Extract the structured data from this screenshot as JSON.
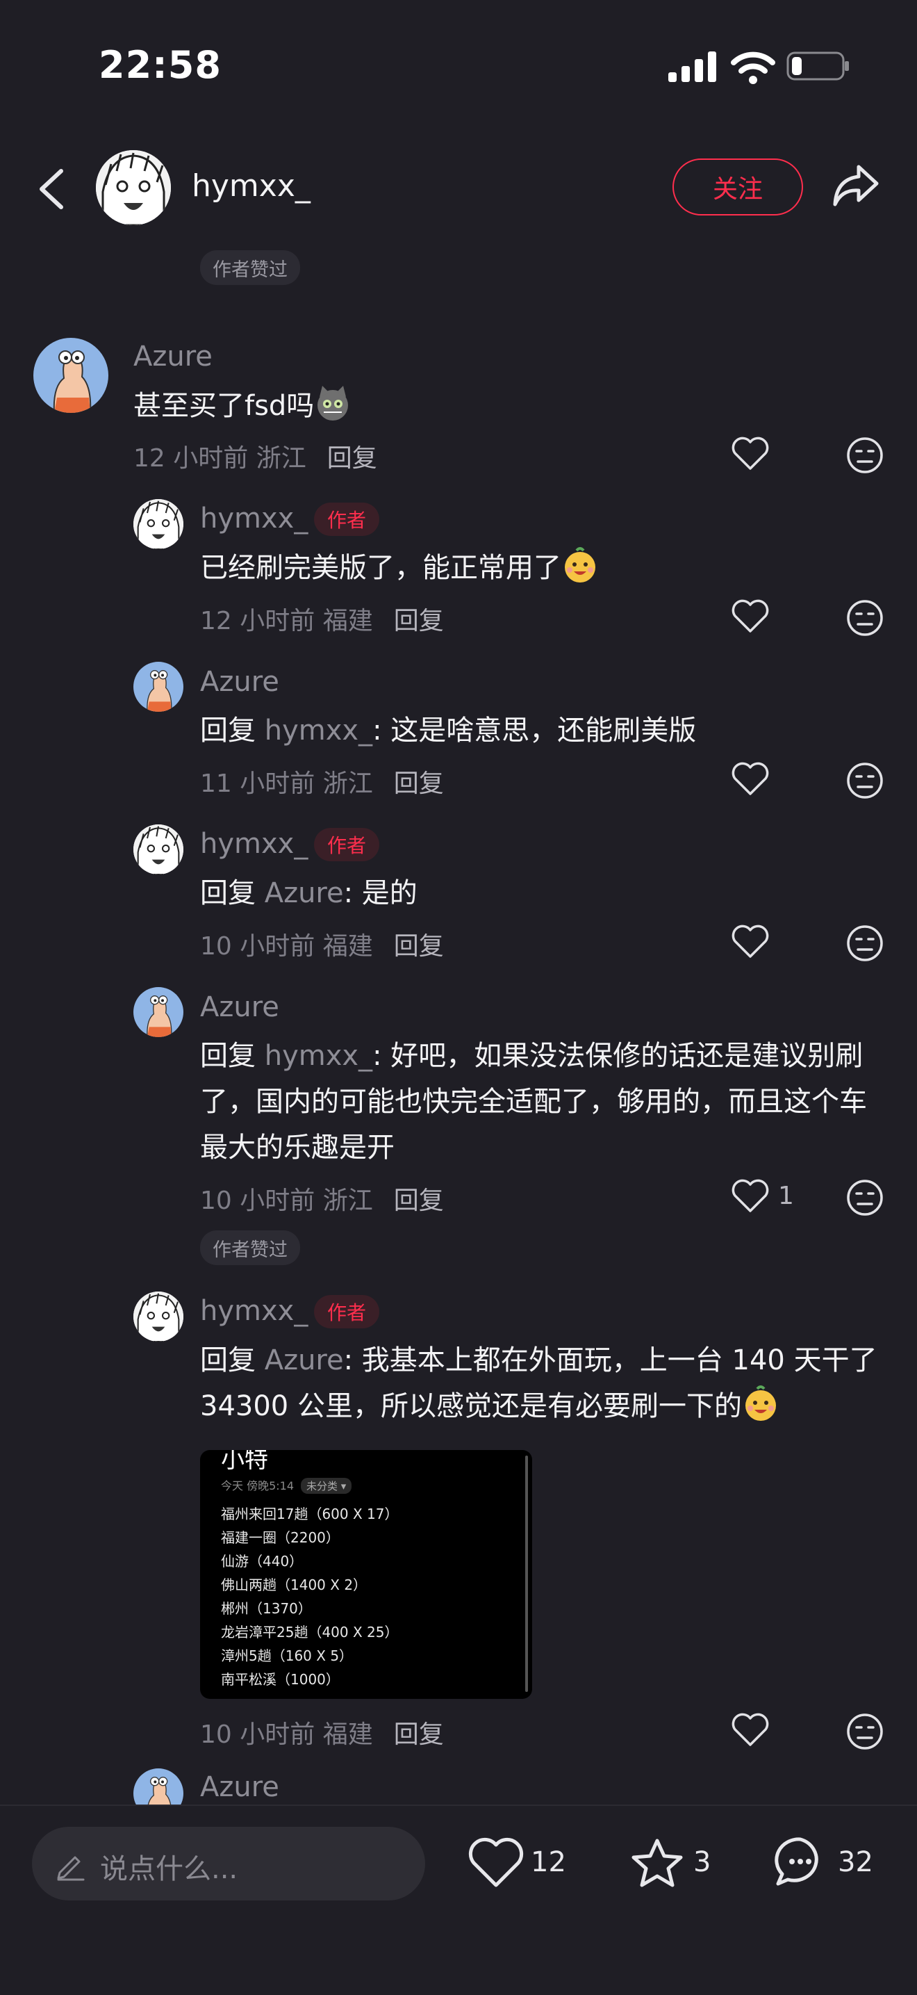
{
  "status_bar": {
    "time": "22:58",
    "battery_percent": 20
  },
  "header": {
    "username": "hymxx_",
    "follow_label": "关注"
  },
  "top_chip": "作者赞过",
  "comments": [
    {
      "user": "Azure",
      "text": "甚至买了fsd吗",
      "emoji": "cat-face-emoji",
      "time": "12 小时前",
      "location": "浙江",
      "reply_label": "回复"
    },
    {
      "user": "hymxx_",
      "author_tag": "作者",
      "text": "已经刷完美版了，能正常用了",
      "emoji": "smiling-emoji",
      "time": "12 小时前",
      "location": "福建",
      "reply_label": "回复"
    },
    {
      "user": "Azure",
      "reply_prefix": "回复",
      "reply_to": "hymxx_",
      "text": ": 这是啥意思，还能刷美版",
      "time": "11 小时前",
      "location": "浙江",
      "reply_label": "回复"
    },
    {
      "user": "hymxx_",
      "author_tag": "作者",
      "reply_prefix": "回复",
      "reply_to": "Azure",
      "text": ": 是的",
      "time": "10 小时前",
      "location": "福建",
      "reply_label": "回复"
    },
    {
      "user": "Azure",
      "reply_prefix": "回复",
      "reply_to": "hymxx_",
      "text": ": 好吧，如果没法保修的话还是建议别刷了，国内的可能也快完全适配了，够用的，而且这个车最大的乐趣是开",
      "time": "10 小时前",
      "location": "浙江",
      "reply_label": "回复",
      "likes": "1"
    },
    {
      "user": "hymxx_",
      "author_tag": "作者",
      "reply_prefix": "回复",
      "reply_to": "Azure",
      "text": ": 我基本上都在外面玩，上一台 140 天干了 34300 公里，所以感觉还是有必要刷一下的",
      "emoji": "smiling-emoji",
      "time": "10 小时前",
      "location": "福建",
      "reply_label": "回复"
    },
    {
      "user": "Azure"
    }
  ],
  "liked_chip": "作者赞过",
  "image_card": {
    "title": "小特",
    "subtitle": "今天 傍晚5:14",
    "tag": "未分类 ▾",
    "lines": [
      "福州来回17趟（600 X 17）",
      "福建一圈（2200）",
      "仙游（440）",
      "佛山两趟（1400 X 2）",
      "郴州（1370）",
      "龙岩漳平25趟（400 X 25）",
      "漳州5趟（160 X 5）",
      "南平松溪（1000）"
    ]
  },
  "bottom_bar": {
    "input_placeholder": "说点什么...",
    "likes": "12",
    "stars": "3",
    "comments": "32"
  },
  "colors": {
    "background": "#1f1e25",
    "accent": "#ff2e4d",
    "muted": "#8e8d96"
  }
}
